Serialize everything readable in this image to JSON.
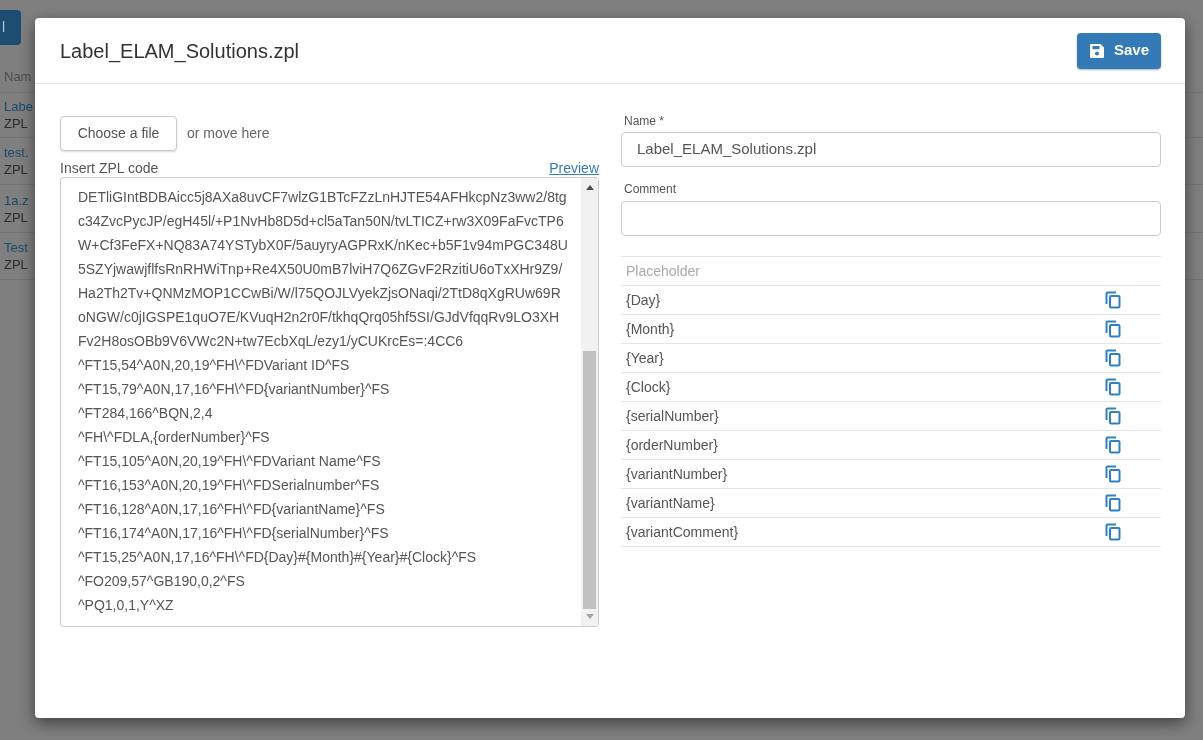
{
  "background": {
    "button": {
      "label": "l"
    },
    "table": {
      "columns": [
        "Nam"
      ],
      "rows": [
        {
          "name": "Labe",
          "type": "ZPL"
        },
        {
          "name": "test.",
          "type": "ZPL"
        },
        {
          "name": "1a.z",
          "type": "ZPL"
        },
        {
          "name": "Test",
          "type": "ZPL"
        }
      ]
    }
  },
  "dialog": {
    "title": "Label_ELAM_Solutions.zpl",
    "save_button": "Save",
    "file_picker": {
      "button": "Choose a file",
      "hint": "or move here"
    },
    "code_editor": {
      "label": "Insert ZPL code",
      "preview_link": "Preview",
      "lines": [
        "DETliGIntBDBAicc5j8AXa8uvCF7wlzG1BTcFZzLnHJTE54AFHkcpNz3ww2/8tg",
        "c34ZvcPycJP/egH45l/+P1NvHb8D5d+cl5aTan50N/tvLTICZ+rw3X09FaFvcTP6",
        "W+Cf3FeFX+NQ83A74YSTybX0F/5auyryAGPRxK/nKec+b5F1v94mPGC348U",
        "5SZYjwawjflfsRnRHWiTnp+Re4X50U0mB7lviH7Q6ZGvF2RzitiU6oTxXHr9Z9/",
        "Ha2Th2Tv+QNMzMOP1CCwBi/W/l75QOJLVyekZjsONaqi/2TtD8qXgRUw69R",
        "oNGW/c0jIGSPE1quO7E/KVuqH2n2r0F/tkhqQrq05hf5SI/GJdVfqqRv9LO3XH",
        "Fv2H8osOBb9V6VWc2N+tw7EcbXqL/ezy1/yCUKrcEs=:4CC6",
        "^FT15,54^A0N,20,19^FH\\^FDVariant ID^FS",
        "^FT15,79^A0N,17,16^FH\\^FD{variantNumber}^FS",
        "^FT284,166^BQN,2,4",
        "^FH\\^FDLA,{orderNumber}^FS",
        "^FT15,105^A0N,20,19^FH\\^FDVariant Name^FS",
        "^FT16,153^A0N,20,19^FH\\^FDSerialnumber^FS",
        "^FT16,128^A0N,17,16^FH\\^FD{variantName}^FS",
        "^FT16,174^A0N,17,16^FH\\^FD{serialNumber}^FS",
        "^FT15,25^A0N,17,16^FH\\^FD{Day}#{Month}#{Year}#{Clock}^FS",
        "^FO209,57^GB190,0,2^FS",
        "^PQ1,0,1,Y^XZ"
      ]
    },
    "name_field": {
      "label": "Name *",
      "value": "Label_ELAM_Solutions.zpl"
    },
    "comment_field": {
      "label": "Comment"
    },
    "placeholders": {
      "header": "Placeholder",
      "items": [
        "{Day}",
        "{Month}",
        "{Year}",
        "{Clock}",
        "{serialNumber}",
        "{orderNumber}",
        "{variantNumber}",
        "{variantName}",
        "{variantComment}"
      ]
    }
  }
}
